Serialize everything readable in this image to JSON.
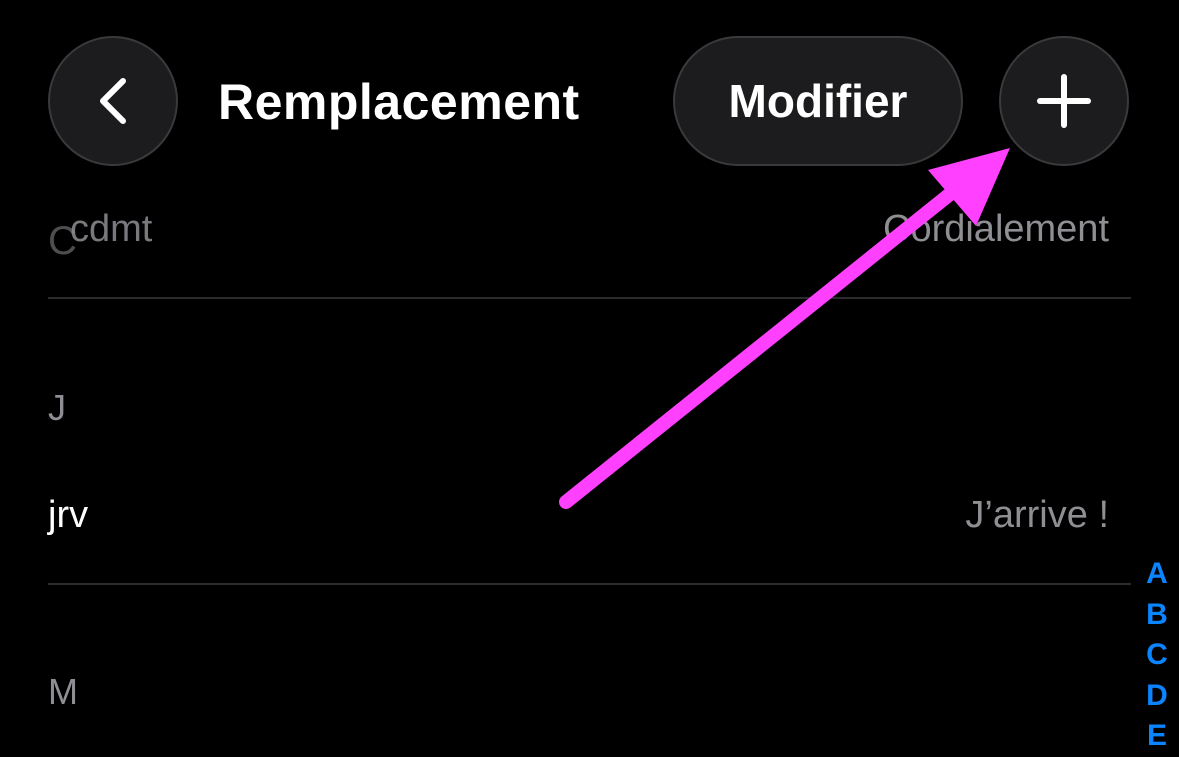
{
  "header": {
    "title": "Remplacement",
    "edit_label": "Modifier",
    "back_icon": "chevron-left-icon",
    "add_icon": "plus-icon"
  },
  "sections": [
    {
      "letter": "C",
      "rows": [
        {
          "shortcut": "cdmt",
          "phrase": "Cordialement"
        }
      ]
    },
    {
      "letter": "J",
      "rows": [
        {
          "shortcut": "jrv",
          "phrase": "J’arrive !"
        }
      ]
    },
    {
      "letter": "M",
      "rows": []
    }
  ],
  "index": [
    "A",
    "B",
    "C",
    "D",
    "E"
  ],
  "colors": {
    "background": "#000000",
    "button_fill": "#1c1c1e",
    "index_accent": "#0a84ff",
    "annotation_arrow": "#ff40ff",
    "secondary_text": "#8e8e93"
  }
}
